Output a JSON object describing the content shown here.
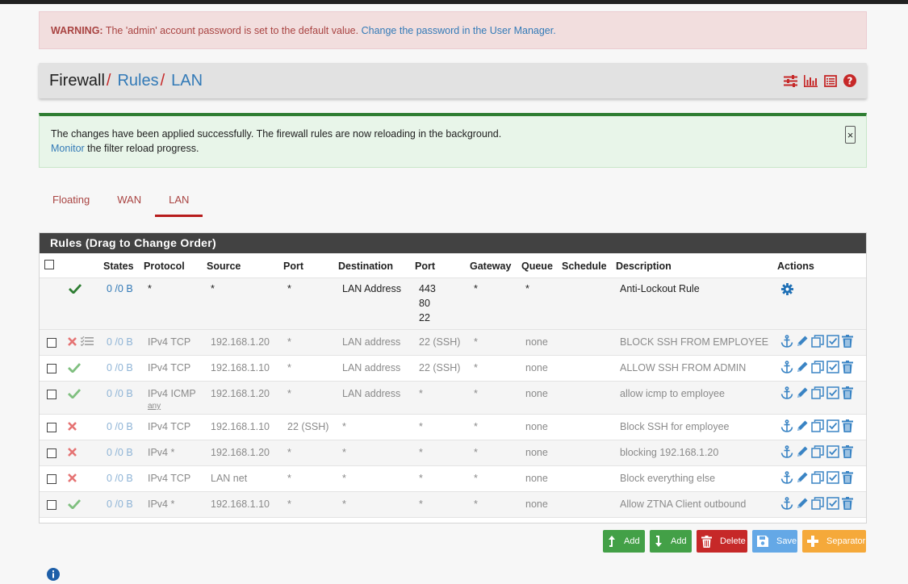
{
  "warning": {
    "label": "WARNING:",
    "text": " The 'admin' account password is set to the default value. ",
    "link": "Change the password in the User Manager."
  },
  "breadcrumb": {
    "root": "Firewall",
    "rules": "Rules",
    "current": "LAN",
    "separator": "/"
  },
  "header_icons": [
    "sliders-icon",
    "bar-chart-icon",
    "list-icon",
    "help-icon"
  ],
  "success": {
    "line1": "The changes have been applied successfully. The firewall rules are now reloading in the background.",
    "link": "Monitor",
    "line2_rest": " the filter reload progress.",
    "close": "×"
  },
  "tabs": [
    {
      "label": "Floating",
      "active": false
    },
    {
      "label": "WAN",
      "active": false
    },
    {
      "label": "LAN",
      "active": true
    }
  ],
  "panel": {
    "title": "Rules (Drag to Change Order)",
    "columns": [
      "States",
      "Protocol",
      "Source",
      "Port",
      "Destination",
      "Port",
      "Gateway",
      "Queue",
      "Schedule",
      "Description",
      "Actions"
    ]
  },
  "rules": [
    {
      "status": "pass",
      "states": "0 /0 B",
      "protocol": "*",
      "protocol_sub": "",
      "source": "*",
      "sport": "*",
      "dest": "LAN Address",
      "dport": [
        "443",
        "80",
        "22"
      ],
      "gateway": "*",
      "queue": "*",
      "schedule": "",
      "description": "Anti-Lockout Rule",
      "fixed": true
    },
    {
      "status": "block",
      "states": "0 /0 B",
      "protocol": "IPv4 TCP",
      "protocol_sub": "",
      "source": "192.168.1.20",
      "sport": "*",
      "dest": "LAN address",
      "dport": [
        "22 (SSH)"
      ],
      "gateway": "*",
      "queue": "none",
      "schedule": "",
      "description": "BLOCK SSH FROM EMPLOYEE",
      "log": true
    },
    {
      "status": "pass",
      "states": "0 /0 B",
      "protocol": "IPv4 TCP",
      "protocol_sub": "",
      "source": "192.168.1.10",
      "sport": "*",
      "dest": "LAN address",
      "dport": [
        "22 (SSH)"
      ],
      "gateway": "*",
      "queue": "none",
      "schedule": "",
      "description": "ALLOW SSH FROM ADMIN"
    },
    {
      "status": "pass",
      "states": "0 /0 B",
      "protocol": "IPv4 ICMP",
      "protocol_sub": "any",
      "source": "192.168.1.20",
      "sport": "*",
      "dest": "LAN address",
      "dport": [
        "*"
      ],
      "gateway": "*",
      "queue": "none",
      "schedule": "",
      "description": "allow icmp to employee"
    },
    {
      "status": "block",
      "states": "0 /0 B",
      "protocol": "IPv4 TCP",
      "protocol_sub": "",
      "source": "192.168.1.10",
      "sport": "22 (SSH)",
      "dest": "*",
      "dport": [
        "*"
      ],
      "gateway": "*",
      "queue": "none",
      "schedule": "",
      "description": "Block SSH for employee"
    },
    {
      "status": "block",
      "states": "0 /0 B",
      "protocol": "IPv4 *",
      "protocol_sub": "",
      "source": "192.168.1.20",
      "sport": "*",
      "dest": "*",
      "dport": [
        "*"
      ],
      "gateway": "*",
      "queue": "none",
      "schedule": "",
      "description": "blocking 192.168.1.20"
    },
    {
      "status": "block",
      "states": "0 /0 B",
      "protocol": "IPv4 TCP",
      "protocol_sub": "",
      "source": "LAN net",
      "sport": "*",
      "dest": "*",
      "dport": [
        "*"
      ],
      "gateway": "*",
      "queue": "none",
      "schedule": "",
      "description": "Block everything else"
    },
    {
      "status": "pass",
      "states": "0 /0 B",
      "protocol": "IPv4 *",
      "protocol_sub": "",
      "source": "192.168.1.10",
      "sport": "*",
      "dest": "*",
      "dport": [
        "*"
      ],
      "gateway": "*",
      "queue": "none",
      "schedule": "",
      "description": "Allow ZTNA Client outbound"
    }
  ],
  "buttons": {
    "add_top": "Add",
    "add_bottom": "Add",
    "delete": "Delete",
    "save": "Save",
    "separator": "Separator"
  },
  "colors": {
    "pass": "#43a047",
    "block": "#e53935",
    "link": "#337ab7",
    "dark_header": "#424242",
    "accent_red": "#b71c1c"
  }
}
